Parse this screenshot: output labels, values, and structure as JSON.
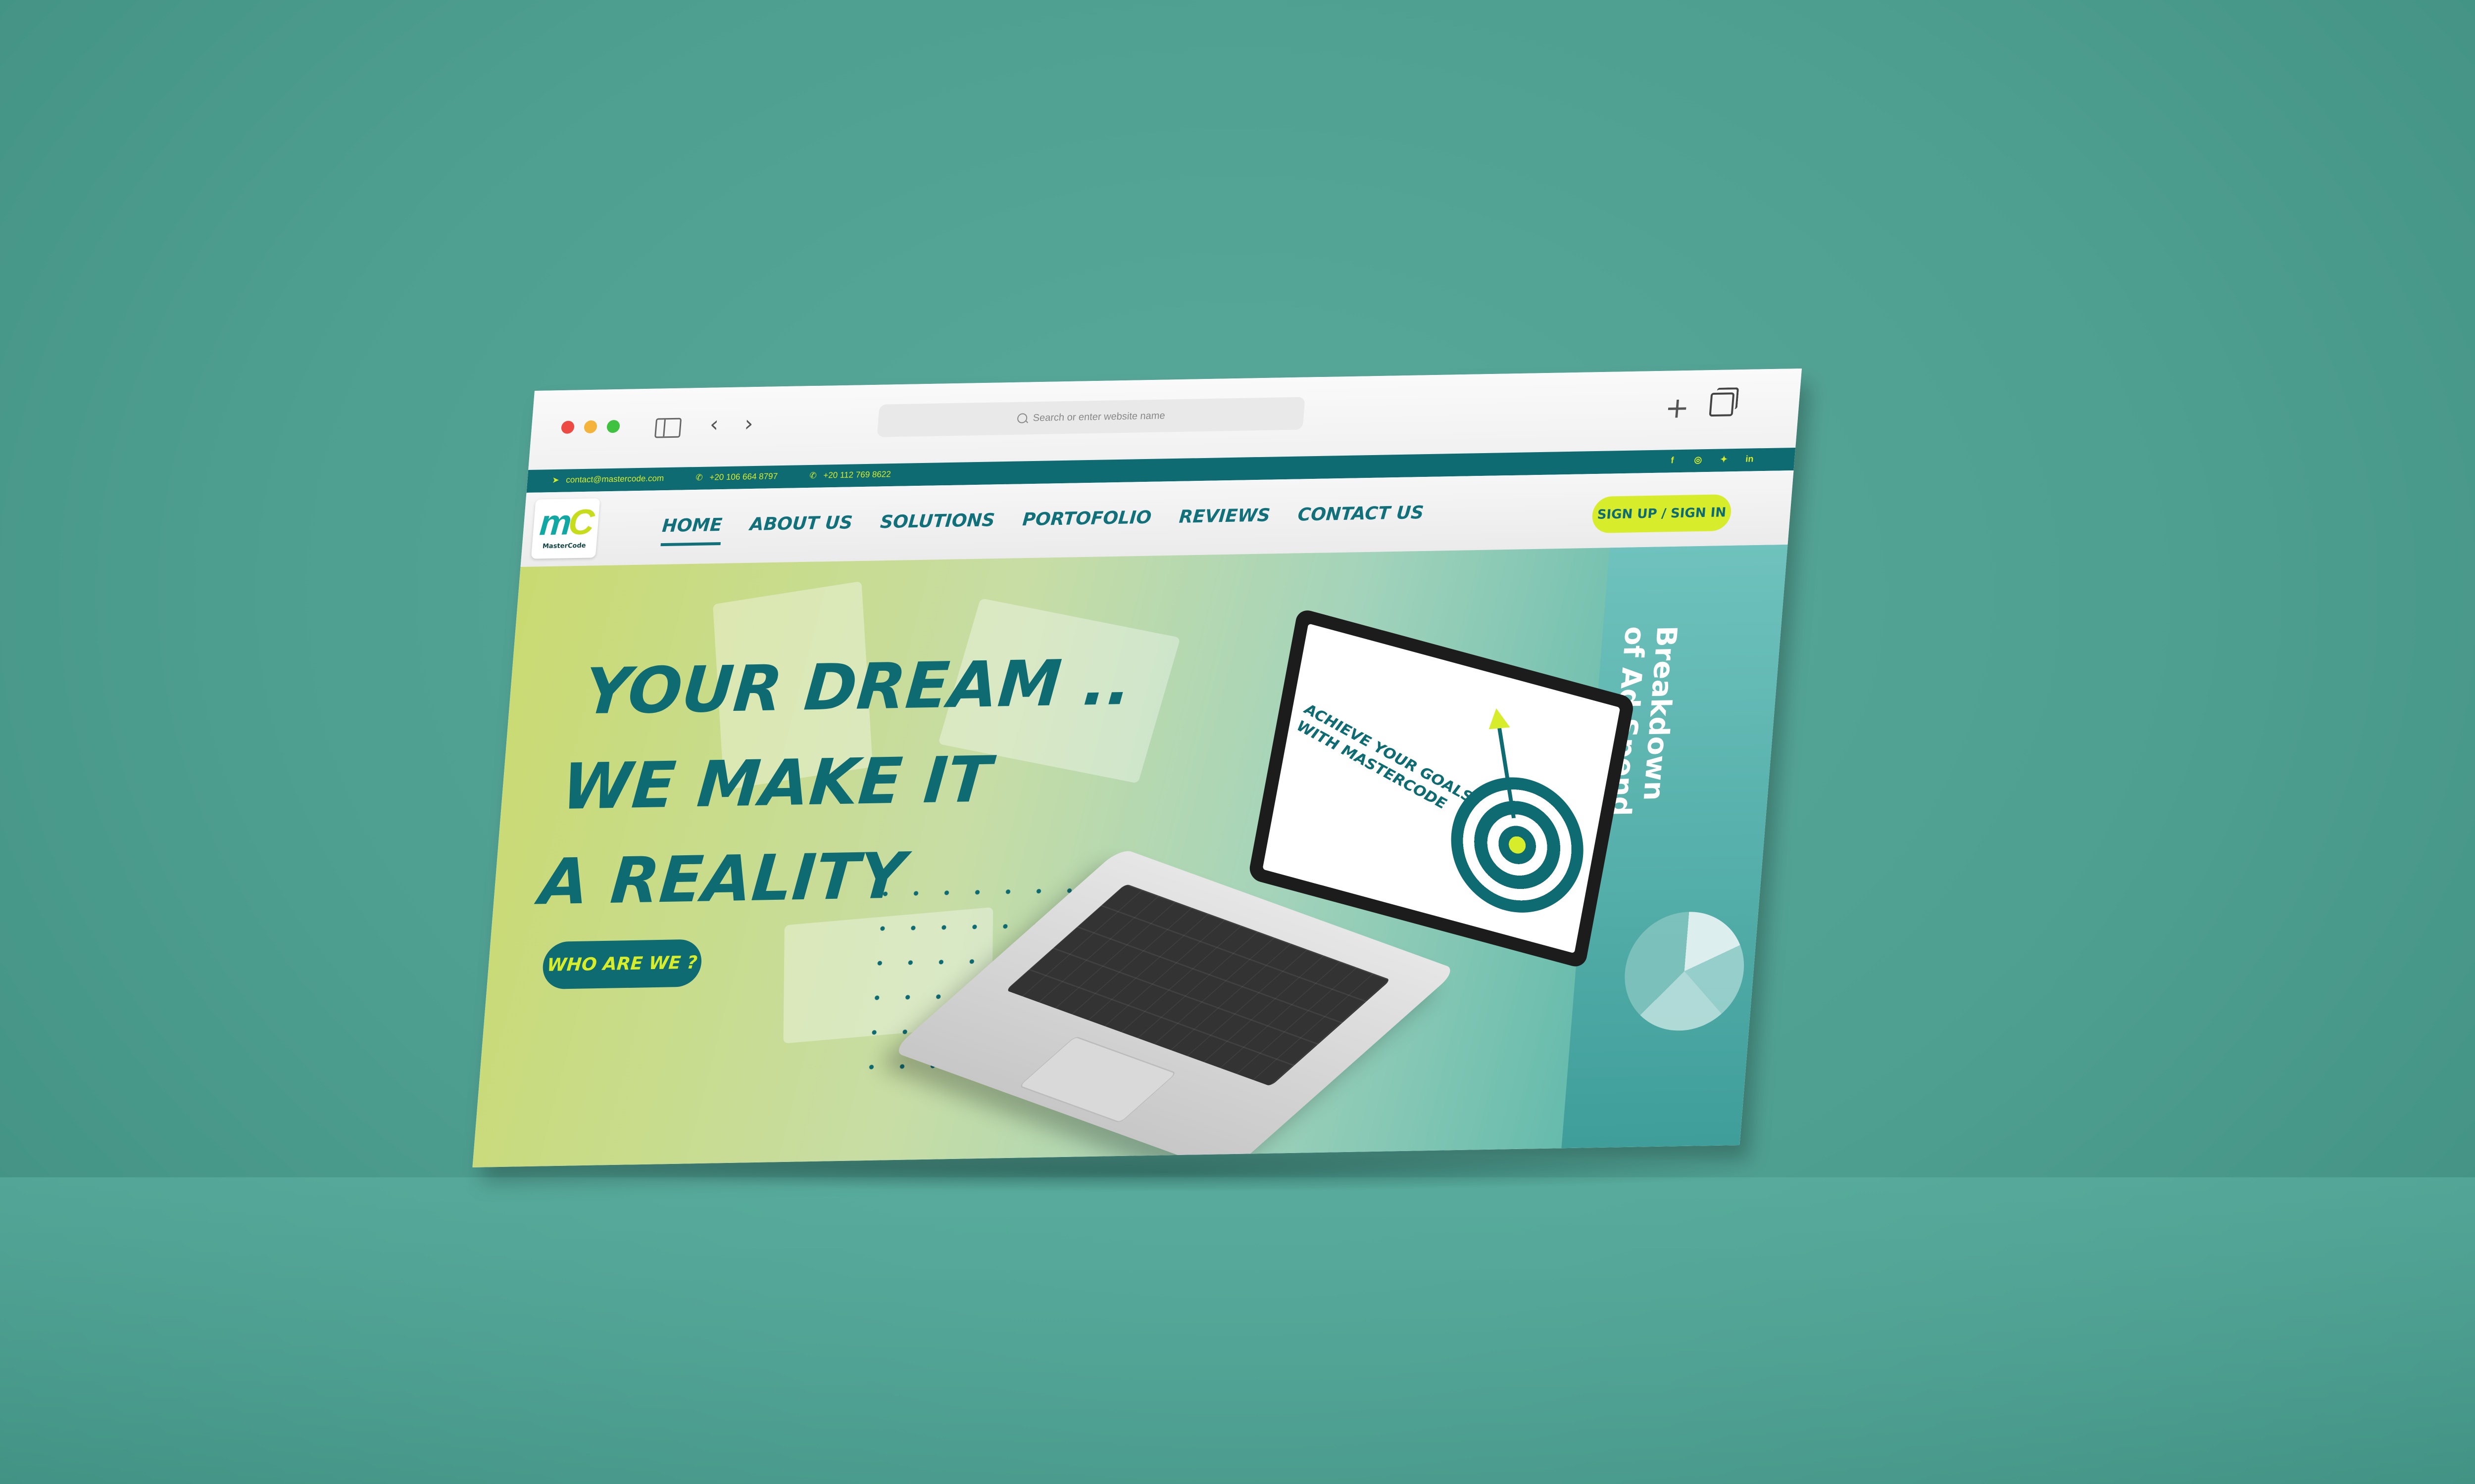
{
  "browser": {
    "url_placeholder": "Search or enter website name"
  },
  "topbar": {
    "email": "contact@mastercode.com",
    "phone1": "+20 106 664 8797",
    "phone2": "+20 112 769 8622",
    "social": [
      "facebook-icon",
      "instagram-icon",
      "twitter-icon",
      "linkedin-icon"
    ]
  },
  "logo": {
    "mark_m": "m",
    "mark_c": "C",
    "text": "MasterCode"
  },
  "nav": {
    "items": [
      "HOME",
      "ABOUT US",
      "SOLUTIONS",
      "PORTOFOLIO",
      "REVIEWS",
      "CONTACT US"
    ],
    "active": "HOME",
    "cta": "SIGN UP / SIGN IN"
  },
  "hero": {
    "line1": "YOUR DREAM ..",
    "line2": "WE MAKE IT",
    "line3": "A REALITY",
    "button": "WHO ARE WE ?"
  },
  "laptop": {
    "screen_line1": "ACHIEVE YOUR GOALS",
    "screen_line2": "WITH MASTERCODE"
  },
  "side": {
    "title_line1": "Breakdown",
    "title_line2": "of Ad Spend"
  },
  "colors": {
    "teal": "#0f6b72",
    "lime": "#d7ec2a",
    "background": "#4f9f91"
  }
}
